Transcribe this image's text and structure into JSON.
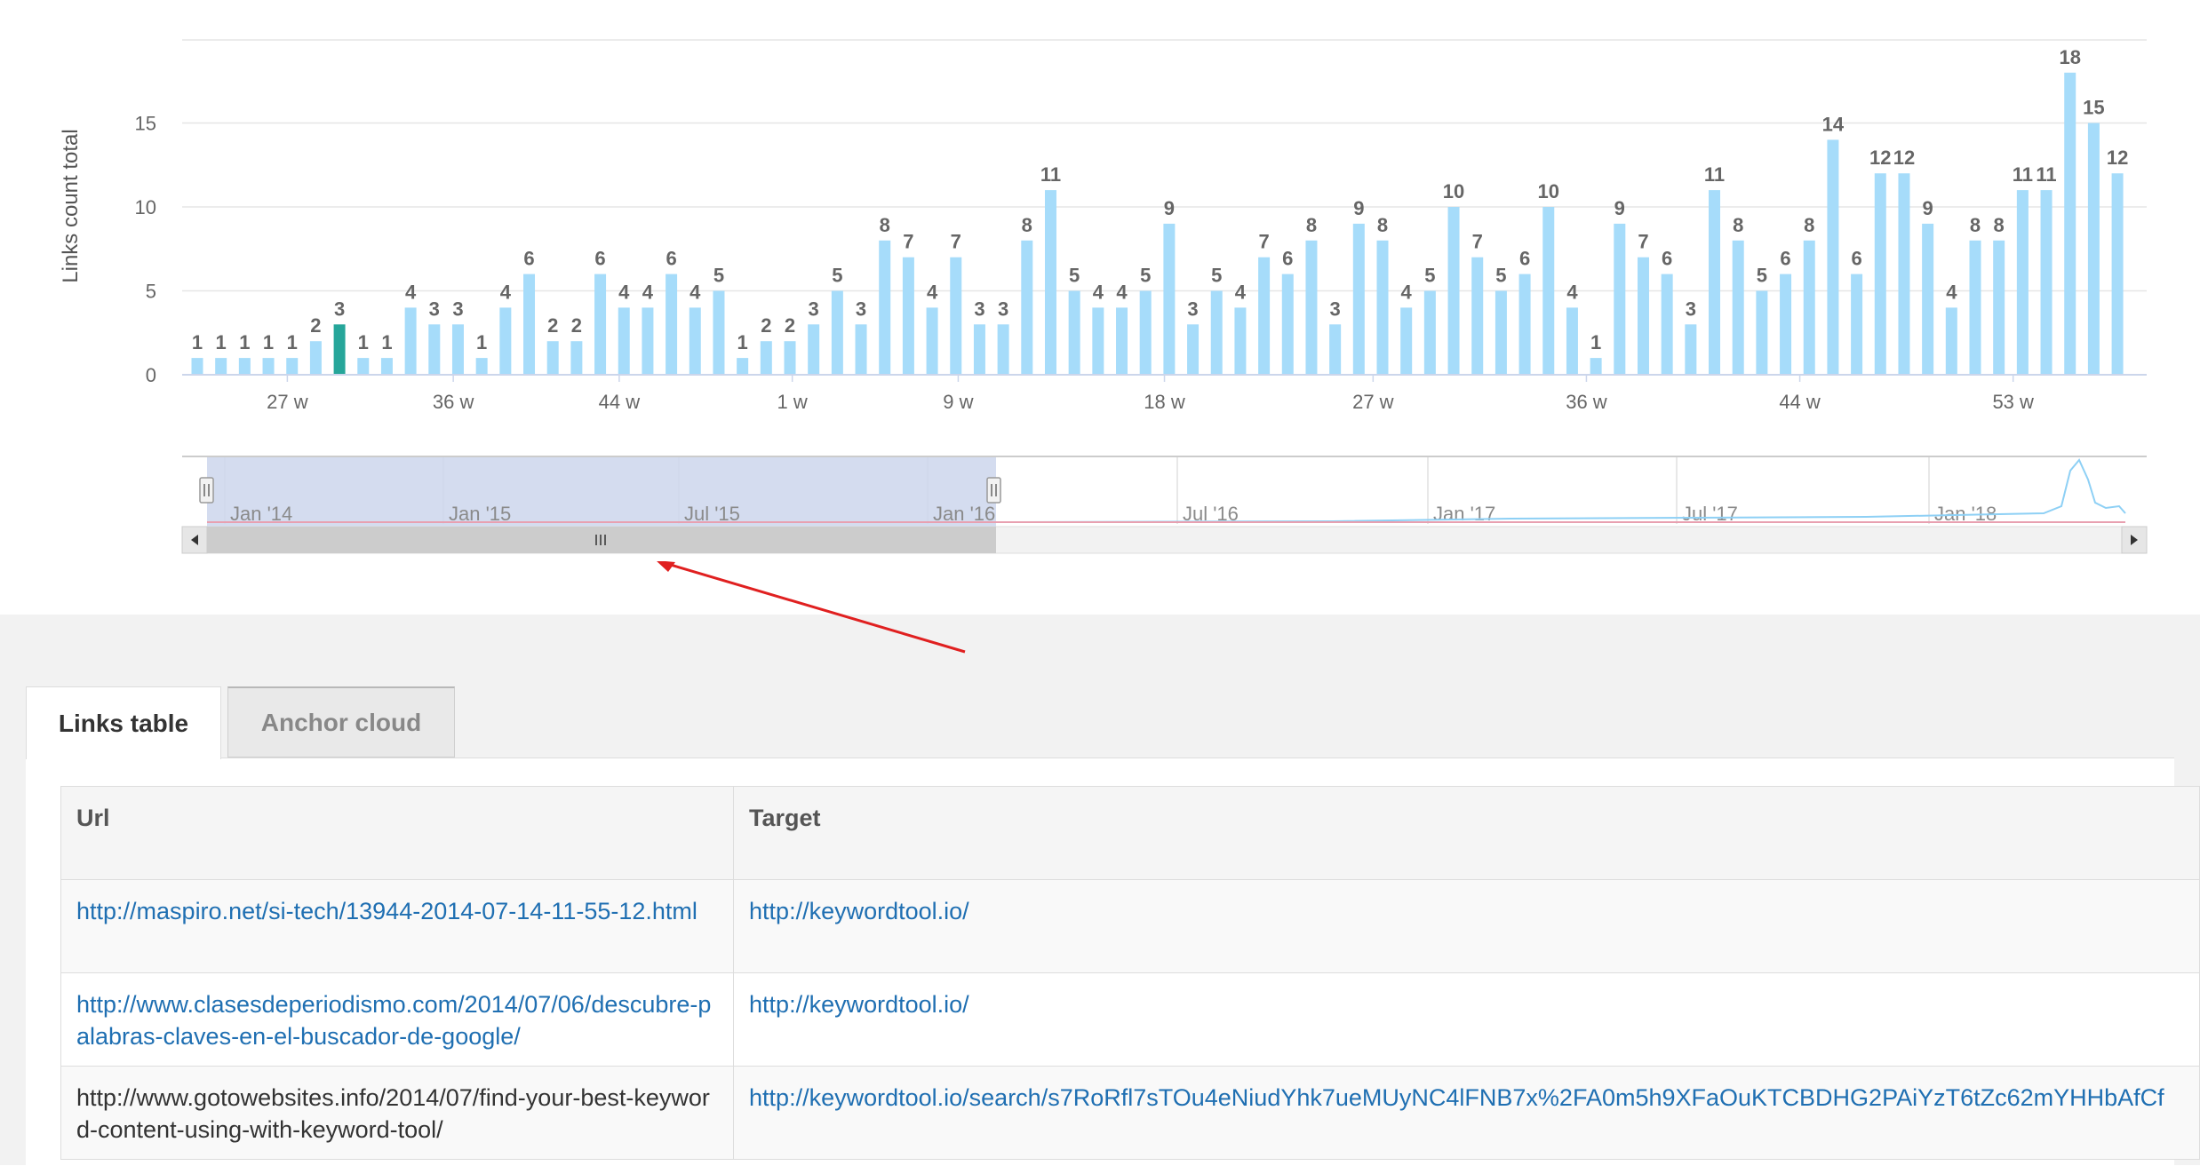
{
  "chart_data": {
    "type": "bar",
    "ylabel": "Links count total",
    "ylim": [
      0,
      19
    ],
    "y_ticks": [
      "0",
      "5",
      "10",
      "15"
    ],
    "x_ticks": [
      "27 w",
      "36 w",
      "44 w",
      "1 w",
      "9 w",
      "18 w",
      "27 w",
      "36 w",
      "44 w",
      "53 w"
    ],
    "x_tick_bar_index": [
      3.8,
      10.8,
      17.8,
      25.1,
      32.1,
      40.8,
      49.6,
      58.6,
      67.6,
      76.6
    ],
    "values": [
      1,
      1,
      1,
      1,
      1,
      2,
      3,
      1,
      1,
      4,
      3,
      3,
      1,
      4,
      6,
      2,
      2,
      6,
      4,
      4,
      6,
      4,
      5,
      1,
      2,
      2,
      3,
      5,
      3,
      8,
      7,
      4,
      7,
      3,
      3,
      8,
      11,
      5,
      4,
      4,
      5,
      9,
      3,
      5,
      4,
      7,
      6,
      8,
      3,
      9,
      8,
      4,
      5,
      10,
      7,
      5,
      6,
      10,
      4,
      1,
      9,
      7,
      6,
      3,
      11,
      8,
      5,
      6,
      8,
      14,
      6,
      12,
      12,
      9,
      4,
      8,
      8,
      11,
      11,
      18,
      15,
      12
    ],
    "highlight_index": 6,
    "colors": {
      "bar": "#a6dcfa",
      "highlight": "#26a69a"
    }
  },
  "navigator": {
    "labels": [
      "Jan '14",
      "Jan '15",
      "Jul '15",
      "Jan '16",
      "Jul '16",
      "Jan '17",
      "Jul '17",
      "Jan '18"
    ],
    "selected_range_fraction": [
      0.0,
      0.385
    ]
  },
  "tabs": {
    "links_table": "Links table",
    "anchor_cloud": "Anchor cloud"
  },
  "table": {
    "headers": {
      "url": "Url",
      "target": "Target"
    },
    "rows": [
      {
        "url": "http://maspiro.net/si-tech/13944-2014-07-14-11-55-12.html",
        "target": "http://keywordtool.io/"
      },
      {
        "url": "http://www.clasesdeperiodismo.com/2014/07/06/descubre-palabras-claves-en-el-buscador-de-google/",
        "target": "http://keywordtool.io/"
      },
      {
        "url": "http://www.gotowebsites.info/2014/07/find-your-best-keyword-content-using-with-keyword-tool/",
        "target": "http://keywordtool.io/search/s7RoRfl7sTOu4eNiudYhk7ueMUyNC4lFNB7x%2FA0m5h9XFaOuKTCBDHG2PAiYzT6tZc62mYHHbAfCf"
      }
    ]
  }
}
